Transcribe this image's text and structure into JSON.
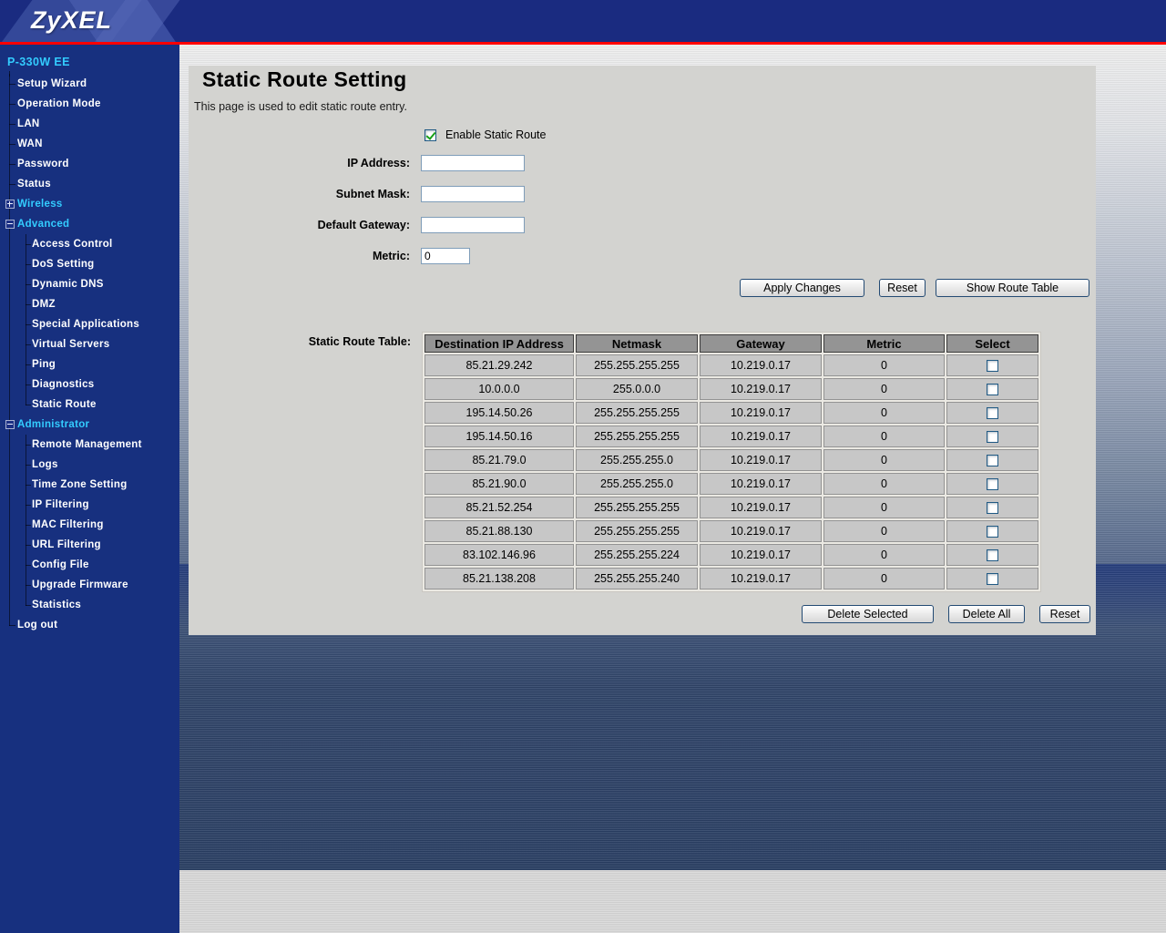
{
  "brand": {
    "logo": "ZyXEL"
  },
  "colors": {
    "header_navy": "#1a2b80",
    "sidebar_navy": "#17307f",
    "accent_cyan": "#33ccff",
    "red_divider": "#fe0000",
    "panel_bg": "#d3d3d0",
    "table_header_bg": "#949494",
    "table_cell_bg": "#c7c7c7",
    "checkbox_check_green": "#18a018"
  },
  "sidebar": {
    "root": "P-330W EE",
    "items": [
      {
        "label": "Setup Wizard",
        "level": 1,
        "l1": "full",
        "tick": true
      },
      {
        "label": "Operation Mode",
        "level": 1,
        "l1": "full",
        "tick": true
      },
      {
        "label": "LAN",
        "level": 1,
        "l1": "full",
        "tick": true
      },
      {
        "label": "WAN",
        "level": 1,
        "l1": "full",
        "tick": true
      },
      {
        "label": "Password",
        "level": 1,
        "l1": "full",
        "tick": true
      },
      {
        "label": "Status",
        "level": 1,
        "l1": "full",
        "tick": true
      },
      {
        "label": "Wireless",
        "level": 1,
        "l1": "full",
        "box": "plus",
        "cyan": true
      },
      {
        "label": "Advanced",
        "level": 1,
        "l1": "full",
        "box": "minus",
        "cyan": true
      },
      {
        "label": "Access Control",
        "level": 2,
        "l1": "full",
        "l2": "full",
        "tick": true
      },
      {
        "label": "DoS Setting",
        "level": 2,
        "l1": "full",
        "l2": "full",
        "tick": true
      },
      {
        "label": "Dynamic DNS",
        "level": 2,
        "l1": "full",
        "l2": "full",
        "tick": true
      },
      {
        "label": "DMZ",
        "level": 2,
        "l1": "full",
        "l2": "full",
        "tick": true
      },
      {
        "label": "Special Applications",
        "level": 2,
        "l1": "full",
        "l2": "full",
        "tick": true
      },
      {
        "label": "Virtual Servers",
        "level": 2,
        "l1": "full",
        "l2": "full",
        "tick": true
      },
      {
        "label": "Ping",
        "level": 2,
        "l1": "full",
        "l2": "full",
        "tick": true
      },
      {
        "label": "Diagnostics",
        "level": 2,
        "l1": "full",
        "l2": "full",
        "tick": true
      },
      {
        "label": "Static Route",
        "level": 2,
        "l1": "full",
        "l2": "half",
        "tick": true
      },
      {
        "label": "Administrator",
        "level": 1,
        "l1": "full",
        "box": "minus",
        "cyan": true
      },
      {
        "label": "Remote Management",
        "level": 2,
        "l1": "full",
        "l2": "full",
        "tick": true
      },
      {
        "label": "Logs",
        "level": 2,
        "l1": "full",
        "l2": "full",
        "tick": true
      },
      {
        "label": "Time Zone Setting",
        "level": 2,
        "l1": "full",
        "l2": "full",
        "tick": true
      },
      {
        "label": "IP Filtering",
        "level": 2,
        "l1": "full",
        "l2": "full",
        "tick": true
      },
      {
        "label": "MAC Filtering",
        "level": 2,
        "l1": "full",
        "l2": "full",
        "tick": true
      },
      {
        "label": "URL Filtering",
        "level": 2,
        "l1": "full",
        "l2": "full",
        "tick": true
      },
      {
        "label": "Config File",
        "level": 2,
        "l1": "full",
        "l2": "full",
        "tick": true
      },
      {
        "label": "Upgrade Firmware",
        "level": 2,
        "l1": "full",
        "l2": "full",
        "tick": true
      },
      {
        "label": "Statistics",
        "level": 2,
        "l1": "full",
        "l2": "half",
        "tick": true
      },
      {
        "label": "Log out",
        "level": 1,
        "l1": "half",
        "tick": true
      }
    ]
  },
  "page": {
    "title": "Static Route Setting",
    "subtitle": "This page is used to edit static route entry.",
    "enable_checkbox": {
      "label": "Enable Static Route",
      "checked": true
    },
    "fields": [
      {
        "label": "IP Address:",
        "value": "",
        "name": "ip-address-field"
      },
      {
        "label": "Subnet Mask:",
        "value": "",
        "name": "subnet-mask-field"
      },
      {
        "label": "Default Gateway:",
        "value": "",
        "name": "default-gateway-field"
      },
      {
        "label": "Metric:",
        "value": "0",
        "name": "metric-field",
        "small": true
      }
    ],
    "action_buttons": [
      {
        "label": "Apply Changes",
        "name": "apply-changes-button"
      },
      {
        "label": "Reset",
        "name": "reset-button"
      },
      {
        "label": "Show Route Table",
        "name": "show-route-table-button"
      }
    ],
    "table_label": "Static Route Table:",
    "table": {
      "headers": [
        "Destination IP Address",
        "Netmask",
        "Gateway",
        "Metric",
        "Select"
      ],
      "rows": [
        {
          "destination": "85.21.29.242",
          "netmask": "255.255.255.255",
          "gateway": "10.219.0.17",
          "metric": "0",
          "selected": false
        },
        {
          "destination": "10.0.0.0",
          "netmask": "255.0.0.0",
          "gateway": "10.219.0.17",
          "metric": "0",
          "selected": false
        },
        {
          "destination": "195.14.50.26",
          "netmask": "255.255.255.255",
          "gateway": "10.219.0.17",
          "metric": "0",
          "selected": false
        },
        {
          "destination": "195.14.50.16",
          "netmask": "255.255.255.255",
          "gateway": "10.219.0.17",
          "metric": "0",
          "selected": false
        },
        {
          "destination": "85.21.79.0",
          "netmask": "255.255.255.0",
          "gateway": "10.219.0.17",
          "metric": "0",
          "selected": false
        },
        {
          "destination": "85.21.90.0",
          "netmask": "255.255.255.0",
          "gateway": "10.219.0.17",
          "metric": "0",
          "selected": false
        },
        {
          "destination": "85.21.52.254",
          "netmask": "255.255.255.255",
          "gateway": "10.219.0.17",
          "metric": "0",
          "selected": false
        },
        {
          "destination": "85.21.88.130",
          "netmask": "255.255.255.255",
          "gateway": "10.219.0.17",
          "metric": "0",
          "selected": false
        },
        {
          "destination": "83.102.146.96",
          "netmask": "255.255.255.224",
          "gateway": "10.219.0.17",
          "metric": "0",
          "selected": false
        },
        {
          "destination": "85.21.138.208",
          "netmask": "255.255.255.240",
          "gateway": "10.219.0.17",
          "metric": "0",
          "selected": false
        }
      ]
    },
    "table_buttons": [
      {
        "label": "Delete Selected",
        "name": "delete-selected-button"
      },
      {
        "label": "Delete All",
        "name": "delete-all-button"
      },
      {
        "label": "Reset",
        "name": "reset-table-button"
      }
    ]
  }
}
